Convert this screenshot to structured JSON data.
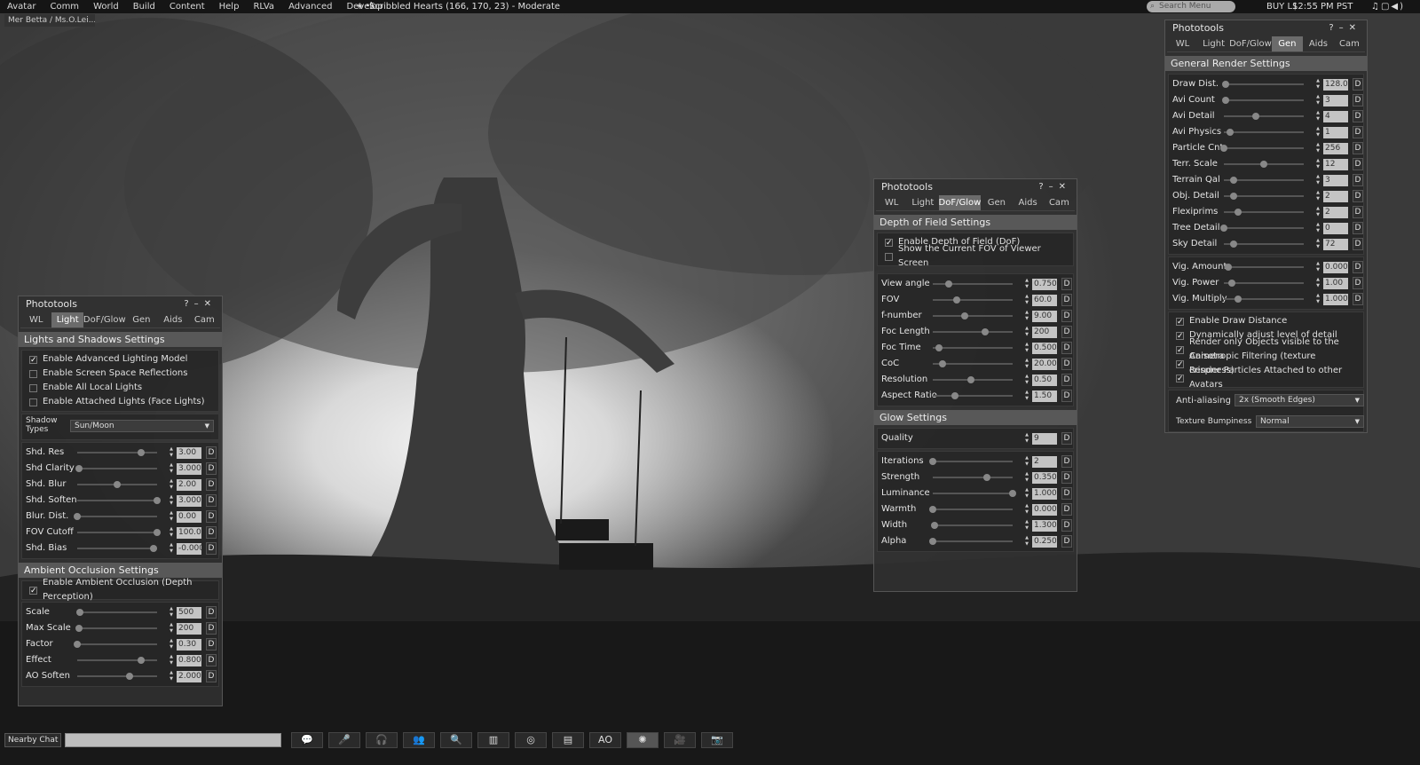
{
  "topbar": {
    "menus": [
      "Avatar",
      "Comm",
      "World",
      "Build",
      "Content",
      "Help",
      "RLVa",
      "Advanced",
      "Develop"
    ],
    "location": "Scribbled Hearts (166, 170, 23) - Moderate",
    "search_placeholder": "Search Menu",
    "buy": "BUY L$",
    "time": "12:55 PM PST"
  },
  "navbar": {
    "text": "Mer Betta / Ms.O.Lei..."
  },
  "panels": {
    "tabs": [
      "WL",
      "Light",
      "DoF/Glow",
      "Gen",
      "Aids",
      "Cam"
    ],
    "title": "Phototools",
    "light": {
      "section1": "Lights and Shadows Settings",
      "checks": [
        {
          "label": "Enable Advanced Lighting Model",
          "on": true
        },
        {
          "label": "Enable Screen Space Reflections",
          "on": false
        },
        {
          "label": "Enable All Local Lights",
          "on": false
        },
        {
          "label": "Enable Attached Lights (Face Lights)",
          "on": false
        }
      ],
      "shadow_label": "Shadow Types",
      "shadow_value": "Sun/Moon",
      "sliders": [
        {
          "label": "Shd. Res",
          "value": "3.00",
          "pos": 0.8
        },
        {
          "label": "Shd Clarity",
          "value": "3.000",
          "pos": 0.02
        },
        {
          "label": "Shd. Blur",
          "value": "2.00",
          "pos": 0.5
        },
        {
          "label": "Shd. Soften",
          "value": "3.000",
          "pos": 1.0
        },
        {
          "label": "Blur. Dist.",
          "value": "0.00",
          "pos": 0.0
        },
        {
          "label": "FOV Cutoff",
          "value": "100.0",
          "pos": 1.0
        },
        {
          "label": "Shd. Bias",
          "value": "-0.000",
          "pos": 0.95
        }
      ],
      "section2": "Ambient Occlusion Settings",
      "ao_check": {
        "label": "Enable Ambient Occlusion (Depth Perception)",
        "on": true
      },
      "ao_sliders": [
        {
          "label": "Scale",
          "value": "500",
          "pos": 0.03
        },
        {
          "label": "Max Scale",
          "value": "200",
          "pos": 0.02
        },
        {
          "label": "Factor",
          "value": "0.30",
          "pos": 0.0
        },
        {
          "label": "Effect",
          "value": "0.800",
          "pos": 0.8
        },
        {
          "label": "AO Soften",
          "value": "2.000",
          "pos": 0.65
        }
      ]
    },
    "dof": {
      "section1": "Depth of Field Settings",
      "checks": [
        {
          "label": "Enable Depth of Field (DoF)",
          "on": true
        },
        {
          "label": "Show the Current FOV of Viewer Screen",
          "on": false
        }
      ],
      "sliders": [
        {
          "label": "View angle",
          "value": "0.750",
          "pos": 0.2
        },
        {
          "label": "FOV",
          "value": "60.0",
          "pos": 0.3
        },
        {
          "label": "f-number",
          "value": "9.00",
          "pos": 0.4
        },
        {
          "label": "Foc Length",
          "value": "200",
          "pos": 0.65
        },
        {
          "label": "Foc Time",
          "value": "0.500",
          "pos": 0.08
        },
        {
          "label": "CoC",
          "value": "20.00",
          "pos": 0.12
        },
        {
          "label": "Resolution",
          "value": "0.50",
          "pos": 0.48
        },
        {
          "label": "Aspect Ratio",
          "value": "1.50",
          "pos": 0.28
        }
      ],
      "section2": "Glow Settings",
      "quality_label": "Quality",
      "quality_value": "9",
      "glow_sliders": [
        {
          "label": "Iterations",
          "value": "2",
          "pos": 0.0
        },
        {
          "label": "Strength",
          "value": "0.350",
          "pos": 0.68
        },
        {
          "label": "Luminance",
          "value": "1.000",
          "pos": 1.0
        },
        {
          "label": "Warmth",
          "value": "0.000",
          "pos": 0.0
        },
        {
          "label": "Width",
          "value": "1.300",
          "pos": 0.02
        },
        {
          "label": "Alpha",
          "value": "0.250",
          "pos": 0.0
        }
      ]
    },
    "gen": {
      "section1": "General Render Settings",
      "sliders": [
        {
          "label": "Draw Dist.",
          "value": "128.0",
          "pos": 0.02
        },
        {
          "label": "Avi Count",
          "value": "3",
          "pos": 0.02
        },
        {
          "label": "Avi Detail",
          "value": "4",
          "pos": 0.4
        },
        {
          "label": "Avi Physics",
          "value": "1",
          "pos": 0.08
        },
        {
          "label": "Particle Cnt",
          "value": "256",
          "pos": 0.0
        },
        {
          "label": "Terr. Scale",
          "value": "12",
          "pos": 0.5
        },
        {
          "label": "Terrain Qal",
          "value": "3",
          "pos": 0.12
        },
        {
          "label": "Obj. Detail",
          "value": "2",
          "pos": 0.12
        },
        {
          "label": "Flexiprims",
          "value": "2",
          "pos": 0.18
        },
        {
          "label": "Tree Detail",
          "value": "0",
          "pos": 0.0
        },
        {
          "label": "Sky Detail",
          "value": "72",
          "pos": 0.12
        }
      ],
      "vig": [
        {
          "label": "Vig. Amount",
          "value": "0.000",
          "pos": 0.06
        },
        {
          "label": "Vig. Power",
          "value": "1.00",
          "pos": 0.1
        },
        {
          "label": "Vig. Multiply",
          "value": "1.000",
          "pos": 0.18
        }
      ],
      "checks": [
        {
          "label": "Enable Draw Distance",
          "on": true
        },
        {
          "label": "Dynamically adjust level of detail",
          "on": true
        },
        {
          "label": "Render only Objects visible to the Camera",
          "on": true
        },
        {
          "label": "Anisotropic Filtering (texture crispness)",
          "on": true
        },
        {
          "label": "Render Particles Attached to other Avatars",
          "on": true
        }
      ],
      "aa_label": "Anti-aliasing",
      "aa_value": "2x (Smooth Edges)",
      "tb_label": "Texture Bumpiness",
      "tb_value": "Normal"
    }
  },
  "bottombar": {
    "chat_label": "Nearby Chat",
    "buttons": [
      "💬",
      "🎤",
      "🎧",
      "👥",
      "🔍",
      "▥",
      "◎",
      "▤",
      "AO",
      "✺",
      "🎥",
      "📷"
    ]
  }
}
